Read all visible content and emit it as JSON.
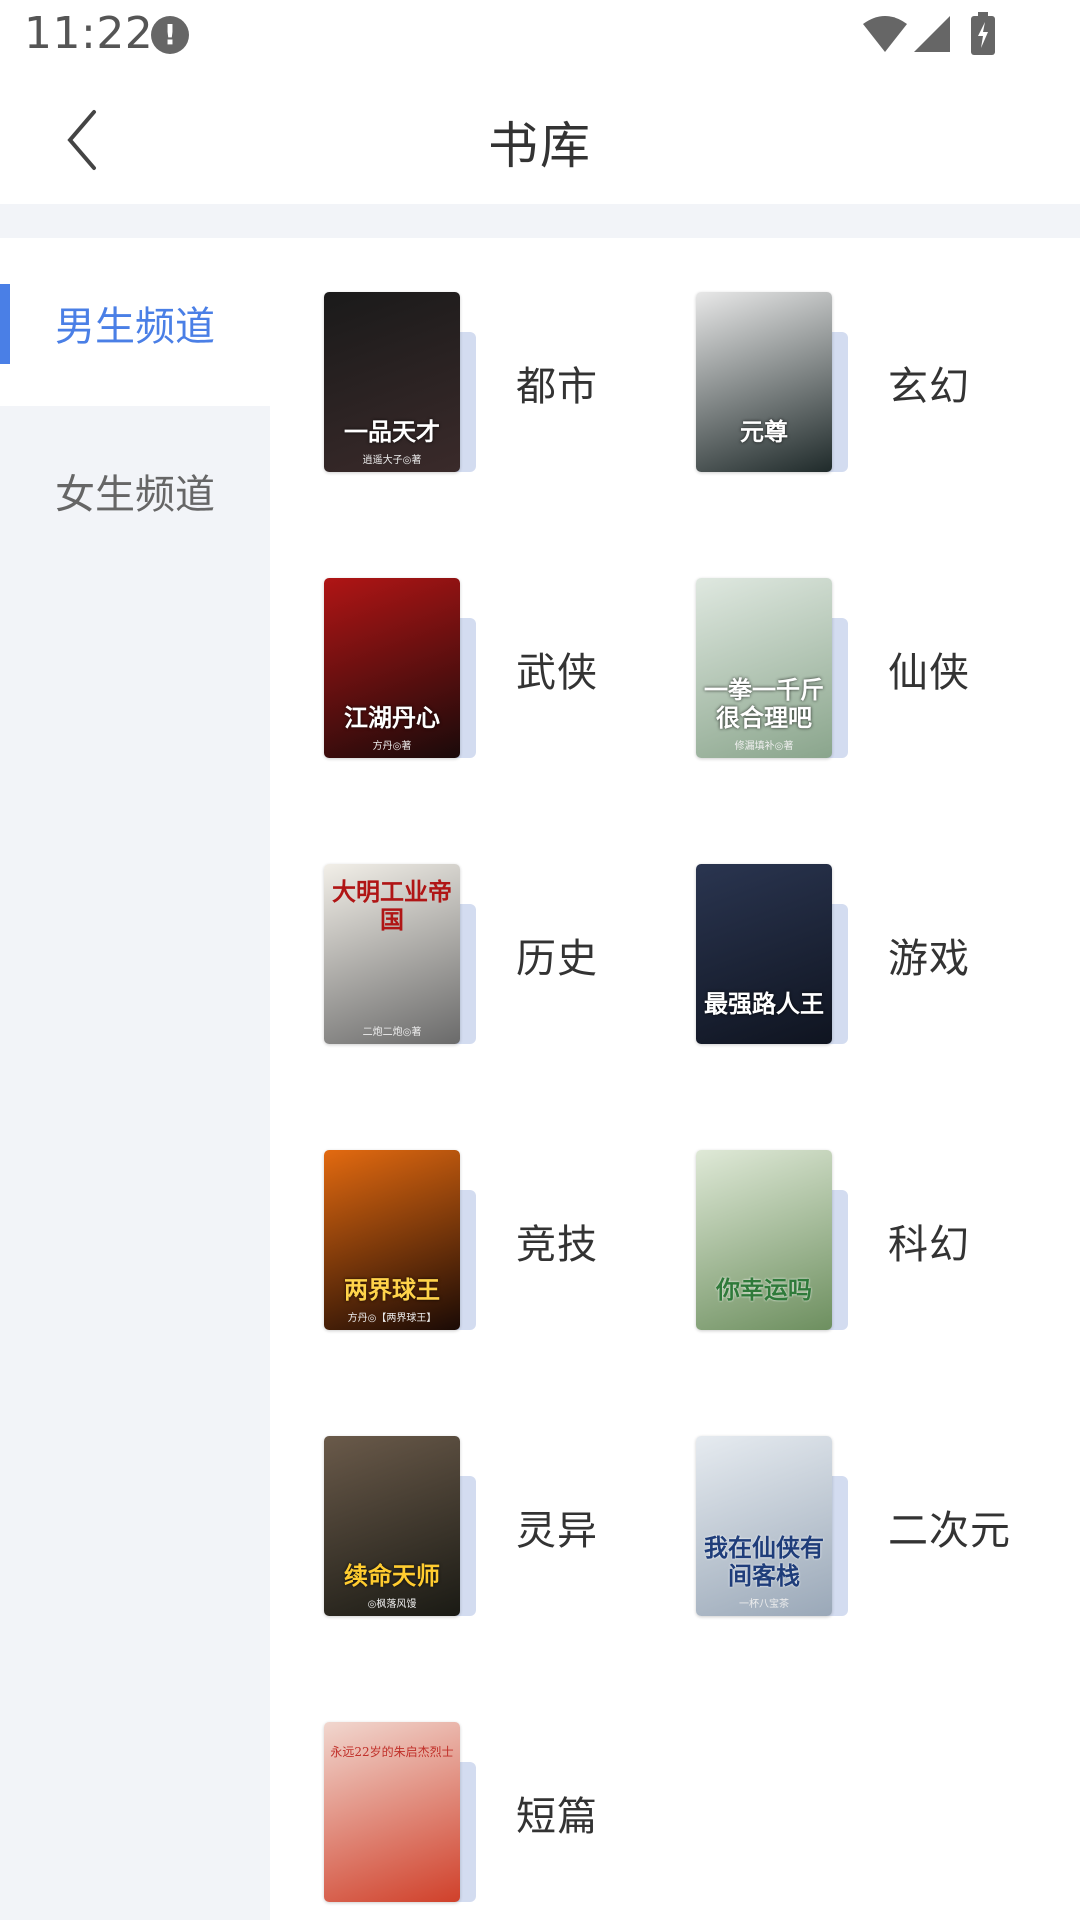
{
  "status_bar": {
    "time": "11:22",
    "alert_glyph": "!",
    "icons": [
      "alert-icon",
      "wifi-icon",
      "signal-icon",
      "battery-icon"
    ]
  },
  "header": {
    "title": "书库",
    "back_icon": "chevron-left-icon"
  },
  "sidebar": {
    "items": [
      {
        "label": "男生频道",
        "active": true
      },
      {
        "label": "女生频道",
        "active": false
      }
    ],
    "accent": "#4a7fe6"
  },
  "categories": [
    {
      "label": "都市",
      "cover_title": "一品天才",
      "cover_author": "逍遥大子◎著",
      "cover_colors": [
        "#1a1a1a",
        "#3a2a2a"
      ]
    },
    {
      "label": "玄幻",
      "cover_title": "元尊",
      "cover_author": "",
      "cover_colors": [
        "#e8e8e8",
        "#1f2a2a"
      ]
    },
    {
      "label": "武侠",
      "cover_title": "江湖丹心",
      "cover_author": "方丹◎著",
      "cover_colors": [
        "#b01515",
        "#1a0a0a"
      ]
    },
    {
      "label": "仙侠",
      "cover_title": "一拳一千斤很合理吧",
      "cover_author": "修漏填补◎著",
      "cover_colors": [
        "#dfe8e0",
        "#8aa58c"
      ]
    },
    {
      "label": "历史",
      "cover_title": "大明工业帝国",
      "cover_author": "二炮二炮◎著",
      "cover_colors": [
        "#f2efe8",
        "#6a6a6a"
      ]
    },
    {
      "label": "游戏",
      "cover_title": "最强路人王",
      "cover_author": "",
      "cover_colors": [
        "#2a3550",
        "#0f1420"
      ]
    },
    {
      "label": "竞技",
      "cover_title": "两界球王",
      "cover_author": "方丹◎【两界球王】",
      "cover_colors": [
        "#e36a10",
        "#1a0a05"
      ]
    },
    {
      "label": "科幻",
      "cover_title": "你幸运吗",
      "cover_author": "",
      "cover_colors": [
        "#dfe9d7",
        "#6d8f5f"
      ]
    },
    {
      "label": "灵异",
      "cover_title": "续命天师",
      "cover_author": "◎枫落风馒",
      "cover_colors": [
        "#6a5a4a",
        "#1a1a14"
      ]
    },
    {
      "label": "二次元",
      "cover_title": "我在仙侠有间客栈",
      "cover_author": "一杯八宝茶",
      "cover_colors": [
        "#e6ebf0",
        "#9aa8b8"
      ]
    },
    {
      "label": "短篇",
      "cover_title": "永远22岁的朱启杰烈士",
      "cover_author": "",
      "cover_colors": [
        "#f1d7cf",
        "#d0402a"
      ]
    }
  ]
}
